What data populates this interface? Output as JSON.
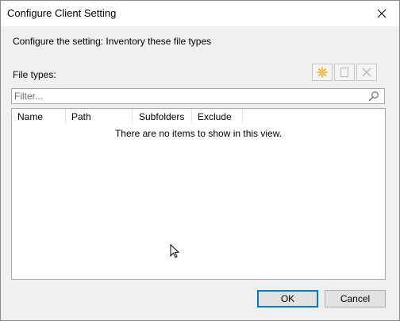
{
  "window": {
    "title": "Configure Client Setting"
  },
  "heading": "Configure the setting: Inventory these file types",
  "file_types_label": "File types:",
  "toolbar": {
    "buttons": [
      "new-icon",
      "properties-icon",
      "delete-icon"
    ]
  },
  "filter": {
    "placeholder": "Filter..."
  },
  "list": {
    "columns": [
      "Name",
      "Path",
      "Subfolders",
      "Exclude"
    ],
    "empty_message": "There are no items to show in this view."
  },
  "buttons": {
    "ok": "OK",
    "cancel": "Cancel"
  },
  "colors": {
    "accent": "#0078d7",
    "new_icon": "#f5a623"
  }
}
